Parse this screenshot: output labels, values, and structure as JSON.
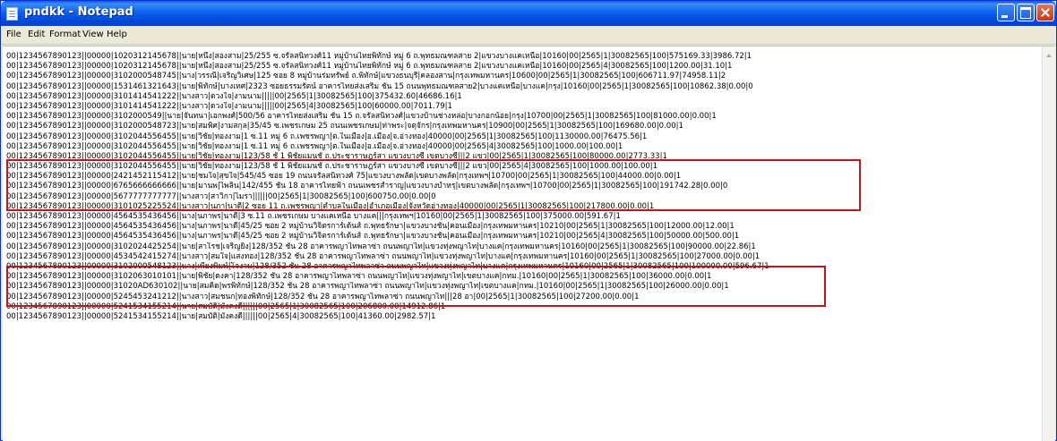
{
  "window": {
    "title": "pndkk - Notepad"
  },
  "menu": [
    "File",
    "Edit",
    "Format",
    "View",
    "Help"
  ],
  "colors": {
    "titlebar": "#0a5ae8",
    "highlight_border": "#c0161b"
  },
  "icons": [
    "notepad-icon",
    "minimize-icon",
    "maximize-icon",
    "close-icon",
    "scroll-up-icon"
  ],
  "lines": [
    "00|1234567890123||00000|1020312145678||นาย|หนึ่ง|สองสาม|25/255 ซ.จรัลสนิทวงศ์11 หมู่บ้านไทยพิทักษ์ หมู่ 6 ถ.พุทธมณฑลสาย 2|แขวงบางแคเหนือ|10160|00|2565|1|30082565|100|575169.33|3986.72|1",
    "00|1234567890123||00000|1020312145678||นาย|หนึ่ง|สองสาม|25/255 ซ.จรัลสนิทวงศ์11 หมู่บ้านไทยพิทักษ์ หมู่ 6 ถ.พุทธมณฑลสาย 2|แขวงบางแคเหนือ|10160|00|2565|4|30082565|100|1200.00|31.10|1",
    "00|1234567890123||00000|3102000548745||นาง|วรรณี|เจริญวิเศษ|125 ซอย 8 หมู่บ้านร่มทรัพย์ ถ.พิทักษ์|แขวงธนบุรี|คลองสาน|กรุงเทพมหานคร|10600|00|2565|1|30082565|100|606711.97|74958.11|2",
    "00|1234567890123||00000|1531461321643||นาย|พิทักษ์|บางเทศ|2323 ซอยธรรมรัตน์ อาคารไทยส่งเสริม ชั้น 15 ถนนพุทธมณฑลสาย2|บางแคเหนือ|บางแค|กรุง|10160|00|2565|1|30082565|100|10862.38|0.00|0",
    "00|1234567890123||00000|3101414541222||นางสาว|ดวงใจ|งามนาม|||||00|2565|1|30082565|100|375432.60|46686.16|1",
    "00|1234567890123||00000|3101414541222||นางสาว|ดวงใจ|งามนาม|||||00|2565|4|30082565|100|60000.00|7011.79|1",
    "00|1234567890123||00000|3102000549||นาย|จันทนา|เอกพงศ์|500/56 อาคารไทยส่งเสริม ชั้น 15 ถ.จรัลสนิทวงศ์|แขวงบ้านช่างหล่อ|บางกอกน้อย|กรุง|10700|00|2565|1|30082565|100|81000.00|0.00|1",
    "00|1234567890123||00000|3102000548723||นาย|สมพิศ|งามสกุล|35/45 ซ.เพชรเกษม 25 ถนนเพชรเกษม|ท่าพระ|จตุจักร|กรุงเทพมหานคร|10900|00|2565|1|30082565|100|169680.00|0.00|1",
    "00|1234567890123||00000|3102044556455||นาย|วิชัย|ทองงาม|1 ซ.11 หมู่ 6 ถ.เพชรพญา|ต.ในเมือง|อ.เมือง|จ.อ่างทอง|40000|00|2565|1|30082565|100|1130000.00|76475.56|1",
    "00|1234567890123||00000|3102044556455||นาย|วิชัย|ทองงาม|1 ซ.11 หมู่ 6 ถ.เพชรพญา|ต.ในเมือง|อ.เมือง|จ.อ่างทอง|40000|00|2565|4|30082565|100|1000.00|100.00|1",
    "00|1234567890123||00000|3102044556455||นาย|วิชัย|ทองงาม|123/58 ชั้ 1 พิชัยแมนชั่ ถ.ประชาราษฎร์สา แขวงบางซื่ เขตบางซื่|||2 แขว|00|2565|1|30082565|100|80000.00|2773.33|1",
    "00|1234567890123||00000|3102044556455||นาย|วิชัย|ทองงาม|123/58 ชั้ 1 พิชัยแมนชั่ ถ.ประชาราษฎร์สา แขวงบางซื่ เขตบางซื่|||2 แขว|00|2565|4|30082565|100|1000.00|100.00|1",
    "00|1234567890123||00000|2421452115412||นาย|ชมใจ|สุขใจ|545/45 ซอย 19 ถนนจรัลสนิทวงศ์ 75|แขวงบางพลัด|เขตบางพลัด|กรุงเทพฯ|10700|00|2565|1|30082565|100|44000.00|0.00|1",
    "00|1234567890123||00000|6765666666666||นาย|มานพ|ไพลิน|142/455 ชั้น 18 อาคารไทยฟ้า ถนนเพชรสำราญ|แขวงบางบำหรุ|เขตบางพลัด|กรุงเทพฯ|10700|00|2565|1|30082565|100|191742.28|0.00|0",
    "00|1234567890123||00000|5677777777777||นางสาว|สาวิกา|ไมรา||||||00|2565|1|30082565|100|600750.00|0.00|0",
    "00|1234567890123||00000|3101025225524||นางสาว|นภา|นาดี|2 ซอย 11 ถ.เพชรพญา|ตำบลในเมือง|อำเภอเมือง|จังหวัดอ่างทอง|40000|00|2565|1|30082565|100|217800.00|0.00|1",
    "00|1234567890123||00000|4564535436456||นาง|นภาพร|นาดี|3 ซ.11 ถ.เพชรเกษม บางแคเหนือ บางแค|||กรุงเทพฯ|10160|00|2565|1|30082565|100|375000.00|591.67|1",
    "00|1234567890123||00000|4564535436456||นาง|นภาพร|นาดี|45/25 ซอย 2 หมู่บ้านวิจิตรการ์เด้นส์ ถ.พุทธรักษา|แขวงบางชัน|คอนเมือง|กรุงเทพมหานคร|10210|00|2565|1|30082565|100|12000.00|12.00|1",
    "00|1234567890123||00000|4564535436456||นาง|นภาพร|นาดี|45/25 ซอย 2 หมู่บ้านวิจิตรการ์เด้นส์ ถ.พุทธรักษา|แขวงบางชัน|คอนเมือง|กรุงเทพมหานคร|10210|00|2565|4|30082565|100|50000.00|500.00|1",
    "00|1234567890123||00000|3102024425254||นาย|สาโรช|เจริญยิ่ง|128/352 ชั้น 28 อาคารพญาไทพลาซ่า ถนนพญาไท|แขวงทุ่งพญาไท|บางแค|กรุงเทพมหานคร|10160|00|2565|1|30082565|100|90000.00|22.86|1",
    "00|1234567890123||00000|4534542415274||นางสาว|สมใจ|แสงทอง|128/352 ชั้น 28 อาคารพญาไทพลาซ่า ถนนพญาไท|แขวงทุ่งพญาไท|บางแค|กรุงเทพมหานคร|10160|00|2565|1|30082565|100|27000.00|0.00|1",
    "00|1234567890123||00000|3102000548123||นาง|เพียงพิมพ์|โจงาม|128/352 ชั้น 28 อาคารพญาไทพลาซ่า ถนนพญาไท|แขวงทุ่งพญาไท|บางแค|กรุงเทพมหานคร|10160|00|2565|1|30082565|100|100000.00|596.67|1",
    "00|1234567890123||00000|3102063010101||นาย|พิชัย|ดงคา|128/352 ชั้น 28 อาคารพญาไทพลาซ่า ถนนพญาไท|แขวงทุ่งพญาไท|เขตบางแค|กทม.|10160|00|2565|1|30082565|100|36000.00|0.00|1",
    "00|1234567890123||00000|31020AD630102||นาย|สมคิด|พรพิทักษ์|128/352 ชั้น 28 อาคารพญาไทพลาซ่า ถนนพญาไท|แขวงทุ่งพญาไท|เขตบางแค|กทม.|10160|00|2565|1|30082565|100|26000.00|0.00|1",
    "00|1234567890123||00000|5245453241212||นางสาว|สมชนก|ทองพิทักษ์|128/352 ชั้น 28 อาคารพญาไทพลาซ่า ถนนพญาไท|||28 อา|00|2565|1|30082565|100|27200.00|0.00|1",
    "00|1234567890123||00000|5241534155214||นาย|สมบัติ|มั่งคงดี||||||00|2565|1|30082565|100|206800.00|14912.86|1",
    "00|1234567890123||00000|5241534155214||นาย|สมบัติ|มั่งคงดี||||||00|2565|4|30082565|100|41360.00|2982.57|1"
  ]
}
